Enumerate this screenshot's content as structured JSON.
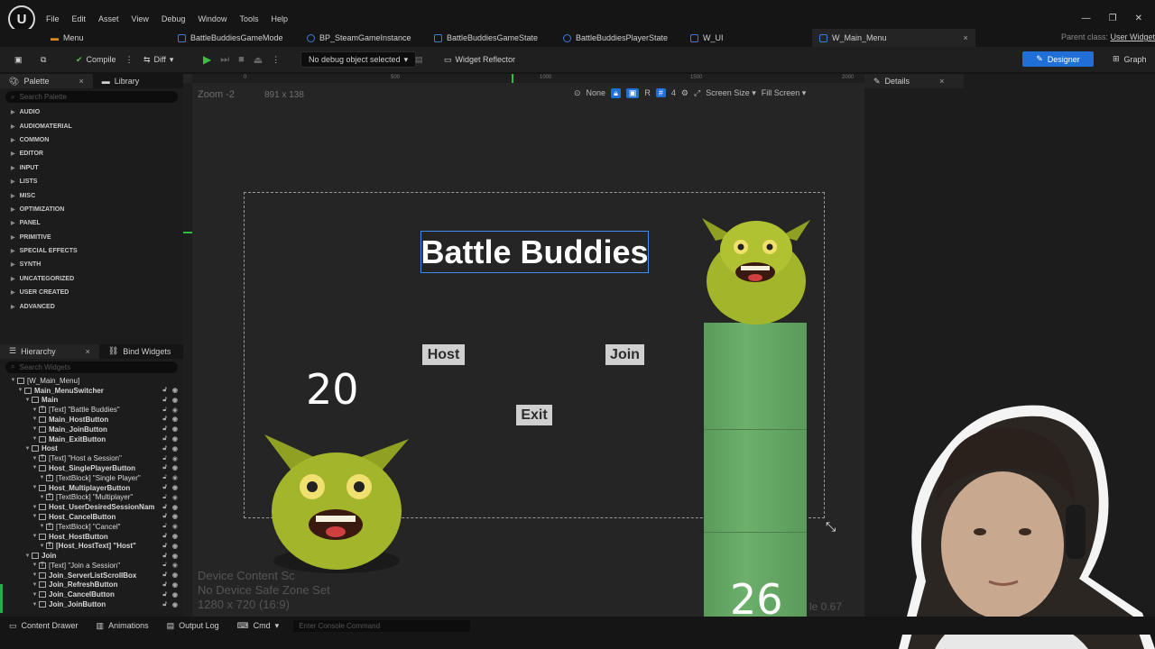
{
  "menubar": {
    "logo": "U",
    "items": [
      "File",
      "Edit",
      "Asset",
      "View",
      "Debug",
      "Window",
      "Tools",
      "Help"
    ],
    "window_controls": [
      "—",
      "❐",
      "✕"
    ]
  },
  "tabs": {
    "menu_label": "Menu",
    "items": [
      "BattleBuddiesGameMode",
      "BP_SteamGameInstance",
      "BattleBuddiesGameState",
      "BattleBuddiesPlayerState",
      "W_UI"
    ],
    "active": "W_Main_Menu",
    "close": "×",
    "parent_class_label": "Parent class:",
    "parent_class_value": "User Widget"
  },
  "toolbar": {
    "compile": "Compile",
    "diff": "Diff",
    "debug_select": "No debug object selected",
    "widget_reflector": "Widget Reflector",
    "designer": "Designer",
    "graph": "Graph"
  },
  "palette": {
    "tab_palette": "Palette",
    "tab_library": "Library",
    "search_placeholder": "Search Palette",
    "categories": [
      "AUDIO",
      "AUDIOMATERIAL",
      "COMMON",
      "EDITOR",
      "INPUT",
      "LISTS",
      "MISC",
      "OPTIMIZATION",
      "PANEL",
      "PRIMITIVE",
      "SPECIAL EFFECTS",
      "SYNTH",
      "UNCATEGORIZED",
      "USER CREATED",
      "ADVANCED"
    ]
  },
  "hierarchy": {
    "tab_hierarchy": "Hierarchy",
    "tab_bind": "Bind Widgets",
    "search_placeholder": "Search Widgets",
    "rows": [
      {
        "label": "[W_Main_Menu]",
        "indent": 0,
        "bold": false
      },
      {
        "label": "Main_MenuSwitcher",
        "indent": 1,
        "bold": true
      },
      {
        "label": "Main",
        "indent": 2,
        "bold": true
      },
      {
        "label": "[Text] \"Battle Buddies\"",
        "indent": 3,
        "bold": false
      },
      {
        "label": "Main_HostButton",
        "indent": 3,
        "bold": true
      },
      {
        "label": "Main_JoinButton",
        "indent": 3,
        "bold": true
      },
      {
        "label": "Main_ExitButton",
        "indent": 3,
        "bold": true
      },
      {
        "label": "Host",
        "indent": 2,
        "bold": true
      },
      {
        "label": "[Text] \"Host a Session\"",
        "indent": 3,
        "bold": false
      },
      {
        "label": "Host_SinglePlayerButton",
        "indent": 3,
        "bold": true
      },
      {
        "label": "[TextBlock] \"Single Player\"",
        "indent": 4,
        "bold": false
      },
      {
        "label": "Host_MultiplayerButton",
        "indent": 3,
        "bold": true
      },
      {
        "label": "[TextBlock] \"Multiplayer\"",
        "indent": 4,
        "bold": false
      },
      {
        "label": "Host_UserDesiredSessionNam",
        "indent": 3,
        "bold": true
      },
      {
        "label": "Host_CancelButton",
        "indent": 3,
        "bold": true
      },
      {
        "label": "[TextBlock] \"Cancel\"",
        "indent": 4,
        "bold": false
      },
      {
        "label": "Host_HostButton",
        "indent": 3,
        "bold": true
      },
      {
        "label": "[Host_HostText] \"Host\"",
        "indent": 4,
        "bold": true
      },
      {
        "label": "Join",
        "indent": 2,
        "bold": true
      },
      {
        "label": "[Text] \"Join a Session\"",
        "indent": 3,
        "bold": false
      },
      {
        "label": "Join_ServerListScrollBox",
        "indent": 3,
        "bold": true
      },
      {
        "label": "Join_RefreshButton",
        "indent": 3,
        "bold": true
      },
      {
        "label": "Join_CancelButton",
        "indent": 3,
        "bold": true
      },
      {
        "label": "Join_JoinButton",
        "indent": 3,
        "bold": true
      }
    ]
  },
  "viewport": {
    "zoom": "Zoom -2",
    "resolution": "891 x 138",
    "ruler_marks": [
      "0",
      "500",
      "1000",
      "1500",
      "2000"
    ],
    "tool_none": "None",
    "tool_r": "R",
    "tool_grid": "4",
    "screen_size": "Screen Size",
    "fill_screen": "Fill Screen",
    "title": "Battle Buddies",
    "host_button": "Host",
    "join_button": "Join",
    "exit_button": "Exit",
    "info_line1": "Device Content Sc",
    "info_line2": "No Device Safe Zone Set",
    "info_line3": "1280 x 720 (16:9)",
    "scale": "le 0.67",
    "overlay_left_number": "20",
    "overlay_right_number": "26"
  },
  "details": {
    "tab": "Details"
  },
  "bottombar": {
    "content_drawer": "Content Drawer",
    "animations": "Animations",
    "output_log": "Output Log",
    "cmd": "Cmd",
    "console_placeholder": "Enter Console Command"
  },
  "colors": {
    "accent": "#1f6fd6",
    "selection": "#3d8bf2",
    "creature": "#a3b52a",
    "pillar": "#6cb06c"
  }
}
